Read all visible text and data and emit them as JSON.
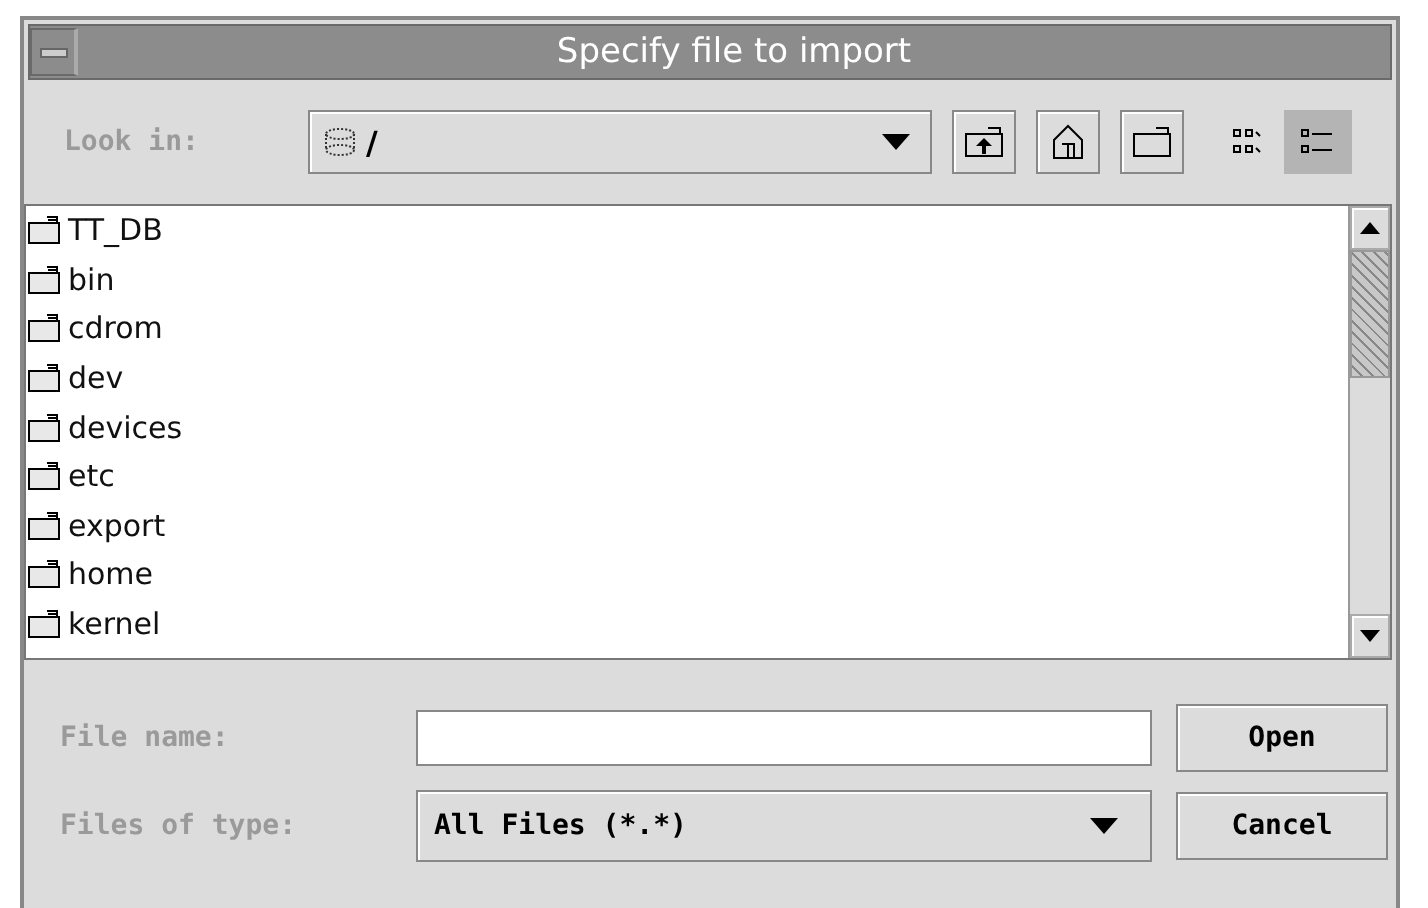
{
  "window": {
    "title": "Specify file to import"
  },
  "look_in": {
    "label": "Look in:",
    "value": "/"
  },
  "view_modes": [
    {
      "kind": "list",
      "selected": false
    },
    {
      "kind": "details",
      "selected": true
    }
  ],
  "files": [
    {
      "name": "TT_DB"
    },
    {
      "name": "bin"
    },
    {
      "name": "cdrom"
    },
    {
      "name": "dev"
    },
    {
      "name": "devices"
    },
    {
      "name": "etc"
    },
    {
      "name": "export"
    },
    {
      "name": "home"
    },
    {
      "name": "kernel"
    }
  ],
  "file_name": {
    "label": "File name:"
  },
  "file_type": {
    "label": "Files of type:",
    "value": "All Files (*.*)"
  },
  "buttons": [
    "Open",
    "Cancel"
  ]
}
